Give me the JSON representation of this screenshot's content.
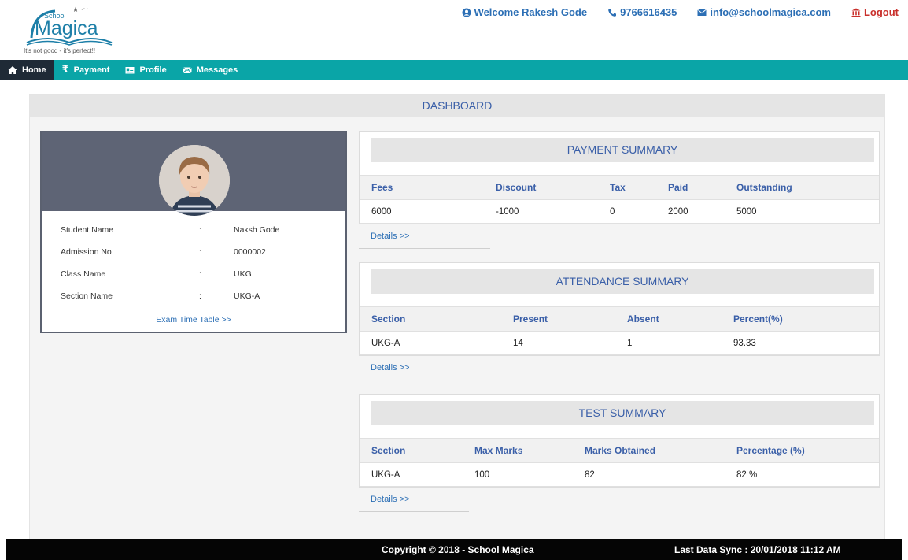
{
  "brand": {
    "school_word": "School",
    "name": "Magica",
    "tagline": "It's not good - it's perfect!!"
  },
  "header": {
    "welcome": "Welcome Rakesh Gode",
    "phone": "9766616435",
    "email": "info@schoolmagica.com",
    "logout": "Logout"
  },
  "nav": {
    "home": "Home",
    "payment": "Payment",
    "profile": "Profile",
    "messages": "Messages"
  },
  "dashboard": {
    "title": "DASHBOARD"
  },
  "student": {
    "rows": [
      {
        "label": "Student Name",
        "sep": ":",
        "value": "Naksh Gode"
      },
      {
        "label": "Admission No",
        "sep": ":",
        "value": "0000002"
      },
      {
        "label": "Class Name",
        "sep": ":",
        "value": "UKG"
      },
      {
        "label": "Section Name",
        "sep": ":",
        "value": "UKG-A"
      }
    ],
    "exam_link": "Exam Time Table >>"
  },
  "payment": {
    "title": "PAYMENT SUMMARY",
    "headers": [
      "Fees",
      "Discount",
      "Tax",
      "Paid",
      "Outstanding"
    ],
    "row": [
      "6000",
      "-1000",
      "0",
      "2000",
      "5000"
    ],
    "details": "Details >>"
  },
  "attendance": {
    "title": "ATTENDANCE SUMMARY",
    "headers": [
      "Section",
      "Present",
      "Absent",
      "Percent(%)"
    ],
    "row": [
      "UKG-A",
      "14",
      "1",
      "93.33"
    ],
    "details": "Details >>"
  },
  "test": {
    "title": "TEST SUMMARY",
    "headers": [
      "Section",
      "Max Marks",
      "Marks Obtained",
      "Percentage (%)"
    ],
    "row": [
      "UKG-A",
      "100",
      "82",
      "82 %"
    ],
    "details": "Details >>"
  },
  "footer": {
    "copyright": "Copyright © 2018 - School Magica",
    "sync": "Last Data Sync : 20/01/2018 11:12 AM"
  },
  "colors": {
    "accent": "#0aa5a7",
    "nav_active": "#1f2a36",
    "link": "#2c6fb5",
    "logout": "#c9302c"
  }
}
